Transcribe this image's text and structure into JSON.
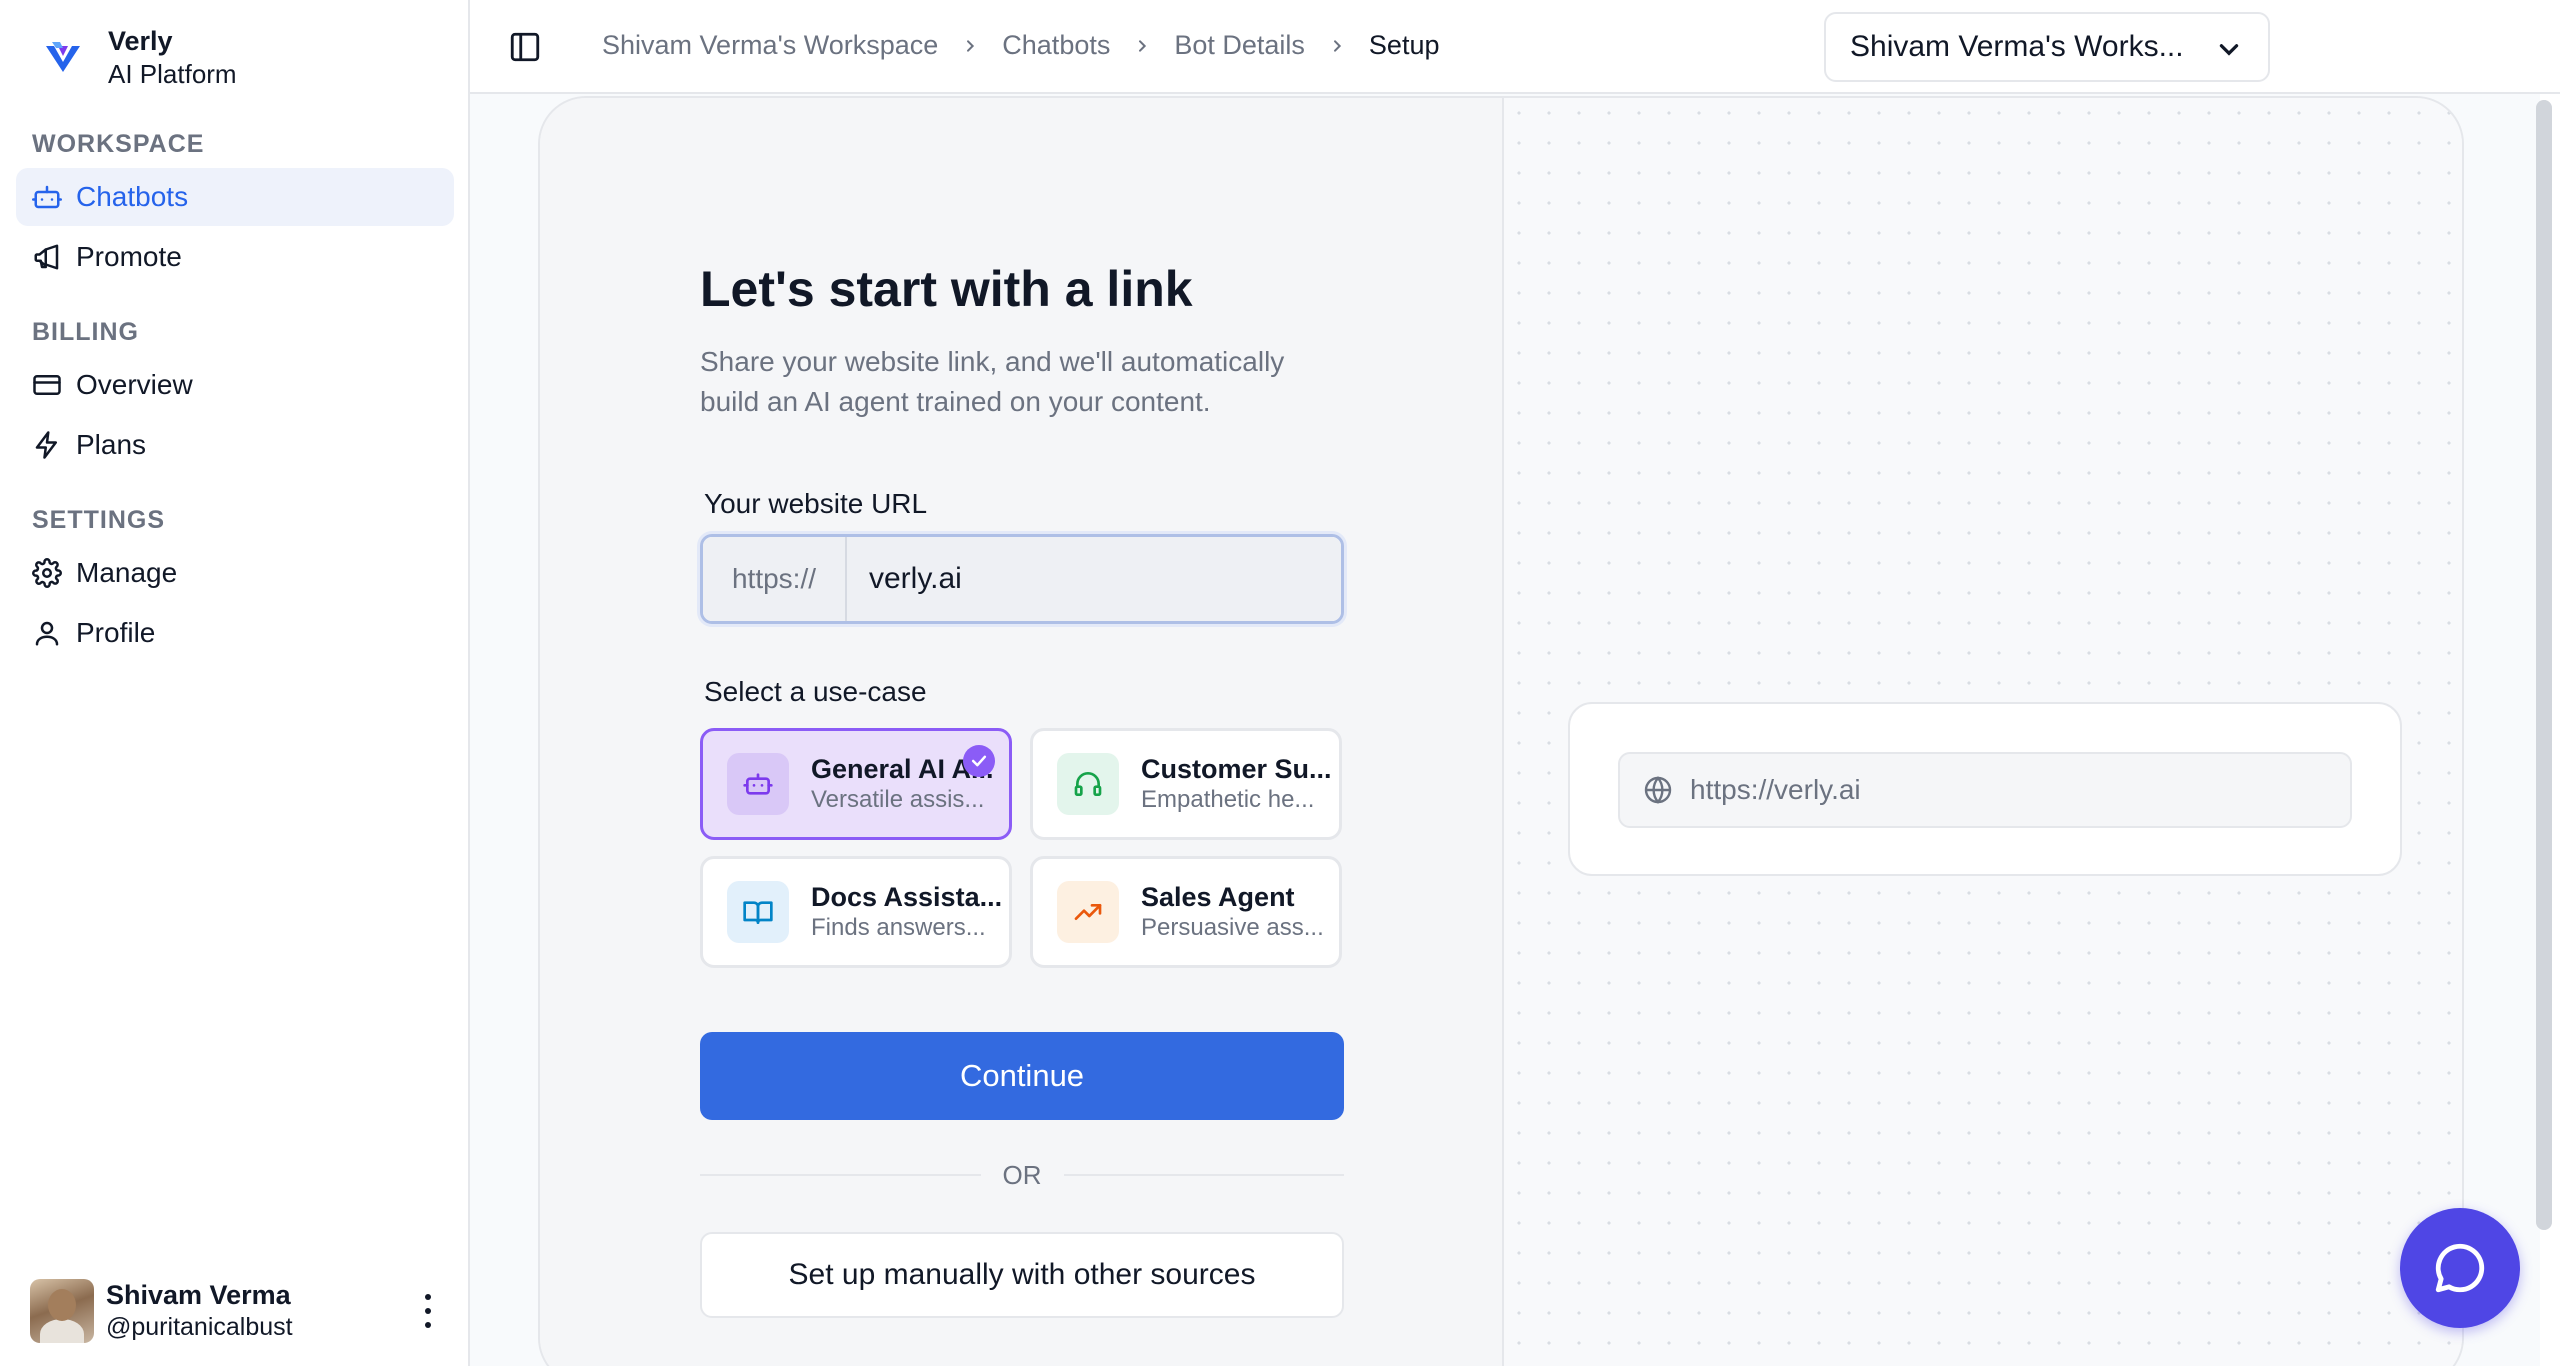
{
  "brand": {
    "name": "Verly",
    "subtitle": "AI Platform"
  },
  "sidebar": {
    "sections": [
      {
        "label": "WORKSPACE",
        "items": [
          {
            "label": "Chatbots",
            "icon": "bot-icon",
            "active": true
          },
          {
            "label": "Promote",
            "icon": "megaphone-icon",
            "active": false
          }
        ]
      },
      {
        "label": "BILLING",
        "items": [
          {
            "label": "Overview",
            "icon": "credit-card-icon",
            "active": false
          },
          {
            "label": "Plans",
            "icon": "lightning-icon",
            "active": false
          }
        ]
      },
      {
        "label": "SETTINGS",
        "items": [
          {
            "label": "Manage",
            "icon": "gear-icon",
            "active": false
          },
          {
            "label": "Profile",
            "icon": "user-icon",
            "active": false
          }
        ]
      }
    ],
    "user": {
      "name": "Shivam Verma",
      "handle": "@puritanicalbust"
    }
  },
  "header": {
    "breadcrumb": [
      "Shivam Verma's Workspace",
      "Chatbots",
      "Bot Details",
      "Setup"
    ],
    "workspace_select": "Shivam Verma's Works..."
  },
  "setup": {
    "title": "Let's start with a link",
    "subtitle": "Share your website link, and we'll automatically build an AI agent trained on your content.",
    "url_label": "Your website URL",
    "url_prefix": "https://",
    "url_value": "verly.ai",
    "usecase_label": "Select a use-case",
    "usecases": [
      {
        "title": "General AI A...",
        "desc": "Versatile assis...",
        "icon": "bot-icon",
        "selected": true
      },
      {
        "title": "Customer Su...",
        "desc": "Empathetic he...",
        "icon": "headset-icon",
        "selected": false
      },
      {
        "title": "Docs Assista...",
        "desc": "Finds answers...",
        "icon": "book-icon",
        "selected": false
      },
      {
        "title": "Sales Agent",
        "desc": "Persuasive ass...",
        "icon": "trending-up-icon",
        "selected": false
      }
    ],
    "continue_label": "Continue",
    "or_label": "OR",
    "manual_label": "Set up manually with other sources"
  },
  "preview": {
    "url": "https://verly.ai"
  },
  "colors": {
    "accent": "#336ae0",
    "active_nav_bg": "#eef2fb",
    "selected_usecase_border": "#8b5cf6",
    "chat_fab": "#4f46e5"
  }
}
